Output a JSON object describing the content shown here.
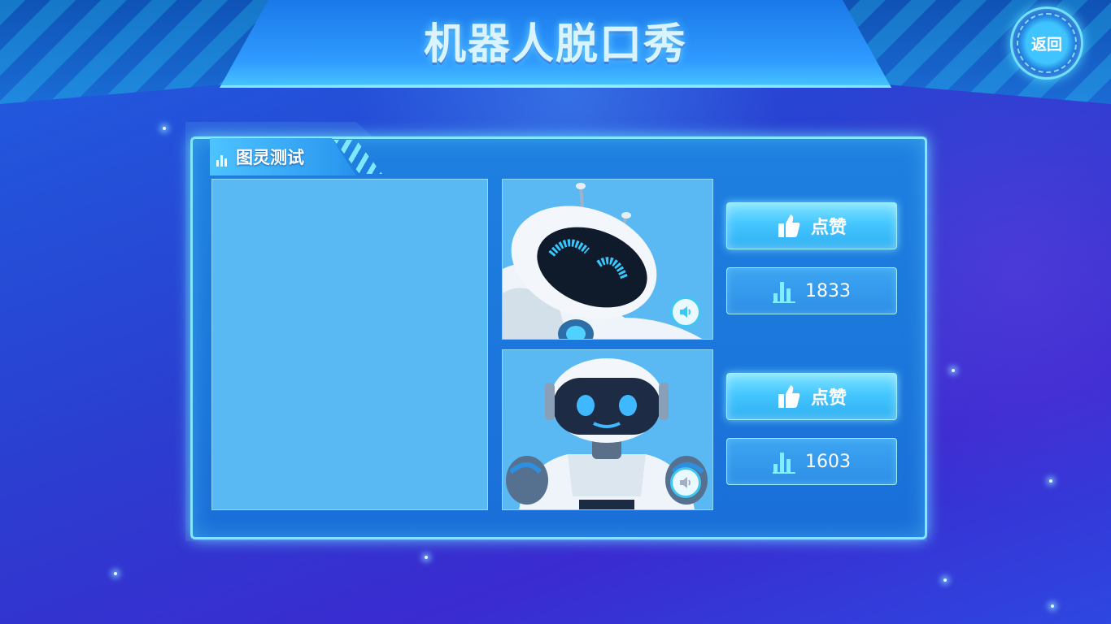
{
  "header": {
    "title": "机器人脱口秀",
    "back_label": "返回"
  },
  "panel": {
    "section_title": "图灵测试"
  },
  "robots": [
    {
      "like_label": "点赞",
      "count": "1833"
    },
    {
      "like_label": "点赞",
      "count": "1603"
    }
  ],
  "colors": {
    "accent": "#7fe8ff",
    "button": "#45c6ff",
    "panel": "#1f80e0",
    "card": "#58b9f3"
  },
  "icons": {
    "like": "thumbs-up-icon",
    "stats": "bar-chart-icon",
    "audio": "speaker-icon",
    "back": "back-icon"
  }
}
